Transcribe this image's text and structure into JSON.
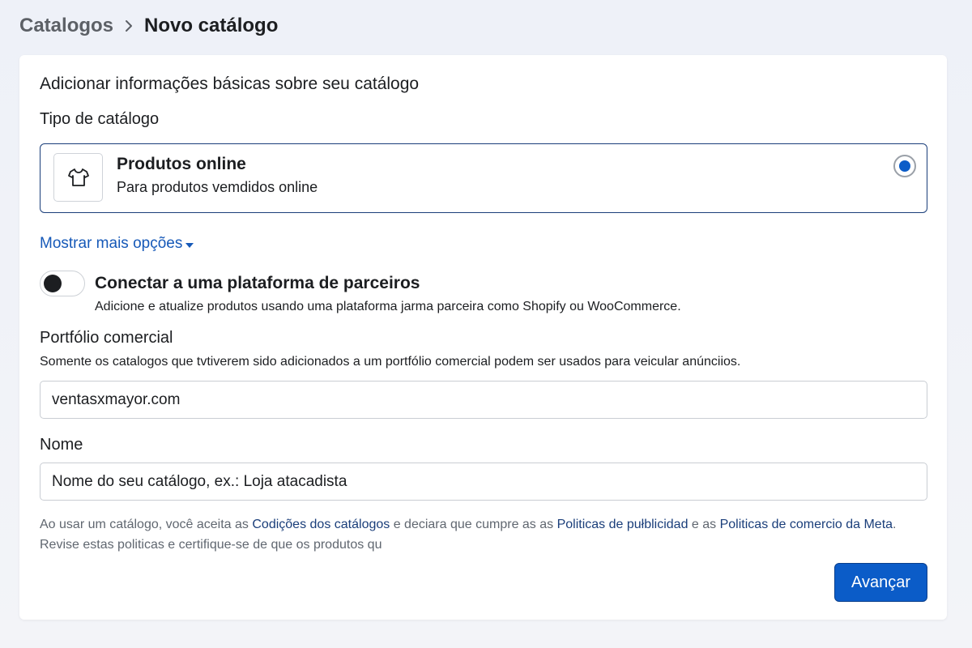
{
  "breadcrumb": {
    "parent": "Catalogos",
    "current": "Novo catálogo"
  },
  "card": {
    "title": "Adicionar informações básicas sobre seu catálogo"
  },
  "catalog_type": {
    "label": "Tipo de catálogo",
    "option": {
      "title": "Produtos online",
      "description": "Para produtos vemdidos online",
      "icon": "tshirt-icon",
      "selected": true
    }
  },
  "more_options": {
    "label": "Mostrar mais opções"
  },
  "partner": {
    "title": "Conectar a uma plataforma de parceiros",
    "description": "Adicione e atualize produtos usando uma plataforma jarma parceira como Shopify ou WooCommerce.",
    "enabled": false
  },
  "portfolio": {
    "label": "Portfólio comercial",
    "description": "Somente os catalogos que tvtiverem sido adicionados a um portfólio comercial podem ser usados para veicular anúnciios.",
    "value": "ventasxmayor.com"
  },
  "name": {
    "label": "Nome",
    "placeholder": "Nome do seu catálogo, ex.: Loja atacadista"
  },
  "legal": {
    "text1": "Ao usar um catálogo, você aceita as ",
    "link1": "Codições  dos catálogos ",
    "text2": " e deciara que cumpre as as ",
    "link2": "Politicas de pułblicidad",
    "text3": "e as ",
    "link3": "Politicas de comercio da Meta",
    "text4": ". Revise estas politicas e certifique-se de que os produtos qu"
  },
  "actions": {
    "next_label": "Avançar"
  },
  "colors": {
    "accent": "#0b5cc8",
    "link": "#1659b8",
    "border_selected": "#1a3e7a"
  }
}
